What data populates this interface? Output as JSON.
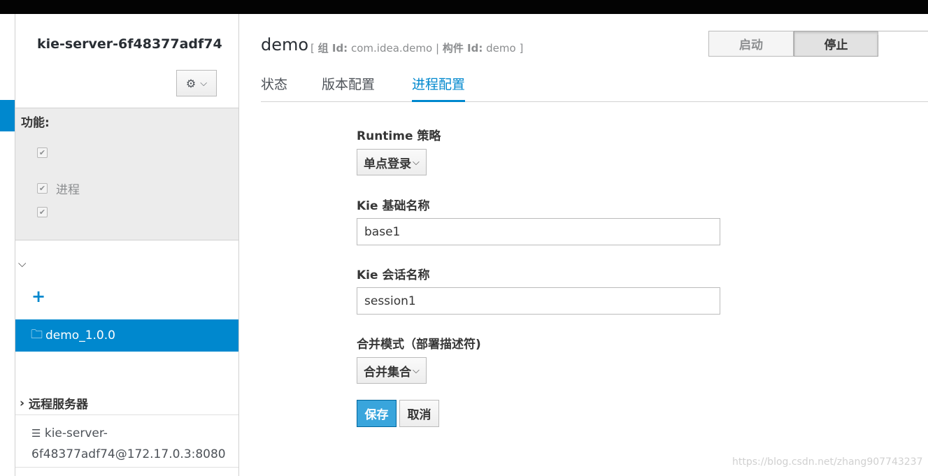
{
  "sidebar": {
    "server_title": "kie-server-6f48377adf74",
    "gear_icon": "gear-icon",
    "capabilities": {
      "title": "功能:",
      "items": [
        {
          "label": "",
          "checked": true
        },
        {
          "label": "进程",
          "checked": true
        },
        {
          "label": "",
          "checked": true
        }
      ]
    },
    "add_icon": "+",
    "container": {
      "label": "demo_1.0.0"
    },
    "remote_servers": {
      "title": "远程服务器",
      "items": [
        {
          "line1": "kie-server-",
          "line2": "6f48377adf74@172.17.0.3:8080"
        }
      ]
    }
  },
  "header": {
    "title": "demo",
    "meta_open": "[",
    "group_label": "组 Id:",
    "group_value": "com.idea.demo",
    "separator": "|",
    "artifact_label": "构件 Id:",
    "artifact_value": "demo",
    "meta_close": "]",
    "start_label": "启动",
    "stop_label": "停止"
  },
  "tabs": [
    {
      "label": "状态",
      "active": false
    },
    {
      "label": "版本配置",
      "active": false
    },
    {
      "label": "进程配置",
      "active": true
    }
  ],
  "form": {
    "runtime_label": "Runtime 策略",
    "runtime_value": "单点登录",
    "kbase_label": "Kie 基础名称",
    "kbase_value": "base1",
    "ksession_label": "Kie 会话名称",
    "ksession_value": "session1",
    "merge_label": "合并模式（部署描述符)",
    "merge_value": "合并集合",
    "save_label": "保存",
    "cancel_label": "取消"
  },
  "watermark": "https://blog.csdn.net/zhang907743237",
  "colors": {
    "accent": "#0088ce",
    "save_button": "#39a5dc"
  }
}
